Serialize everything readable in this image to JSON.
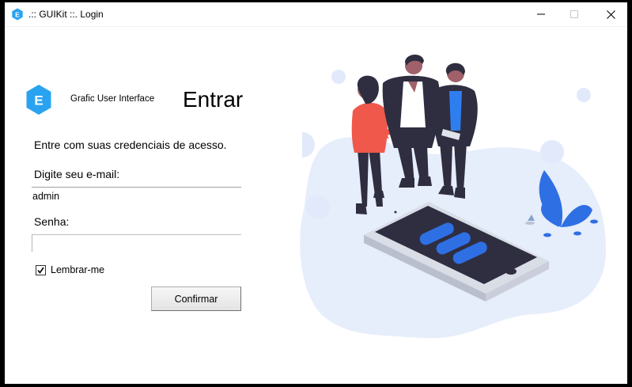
{
  "window": {
    "title": ".:: GUIKit ::. Login",
    "app_icon_letter": "E"
  },
  "brand": {
    "logo_letter": "E",
    "subtitle": "Grafic User Interface",
    "color": "#29a3f0"
  },
  "form": {
    "heading": "Entrar",
    "instruction": "Entre com suas credenciais de acesso.",
    "email_label": "Digite seu e-mail:",
    "email_value": "admin",
    "password_label": "Senha:",
    "password_value": "",
    "remember_label": "Lembrar-me",
    "remember_checked": true,
    "confirm_label": "Confirmar"
  },
  "icons": {
    "minimize": "minimize-icon",
    "maximize": "maximize-icon",
    "close": "close-icon",
    "checkmark": "check-icon"
  },
  "colors": {
    "accent": "#2f6fe4",
    "blob": "#e6edfb",
    "shirt_red": "#f0584b",
    "shirt_blue": "#2f7ef0",
    "suit": "#2f2e41"
  }
}
